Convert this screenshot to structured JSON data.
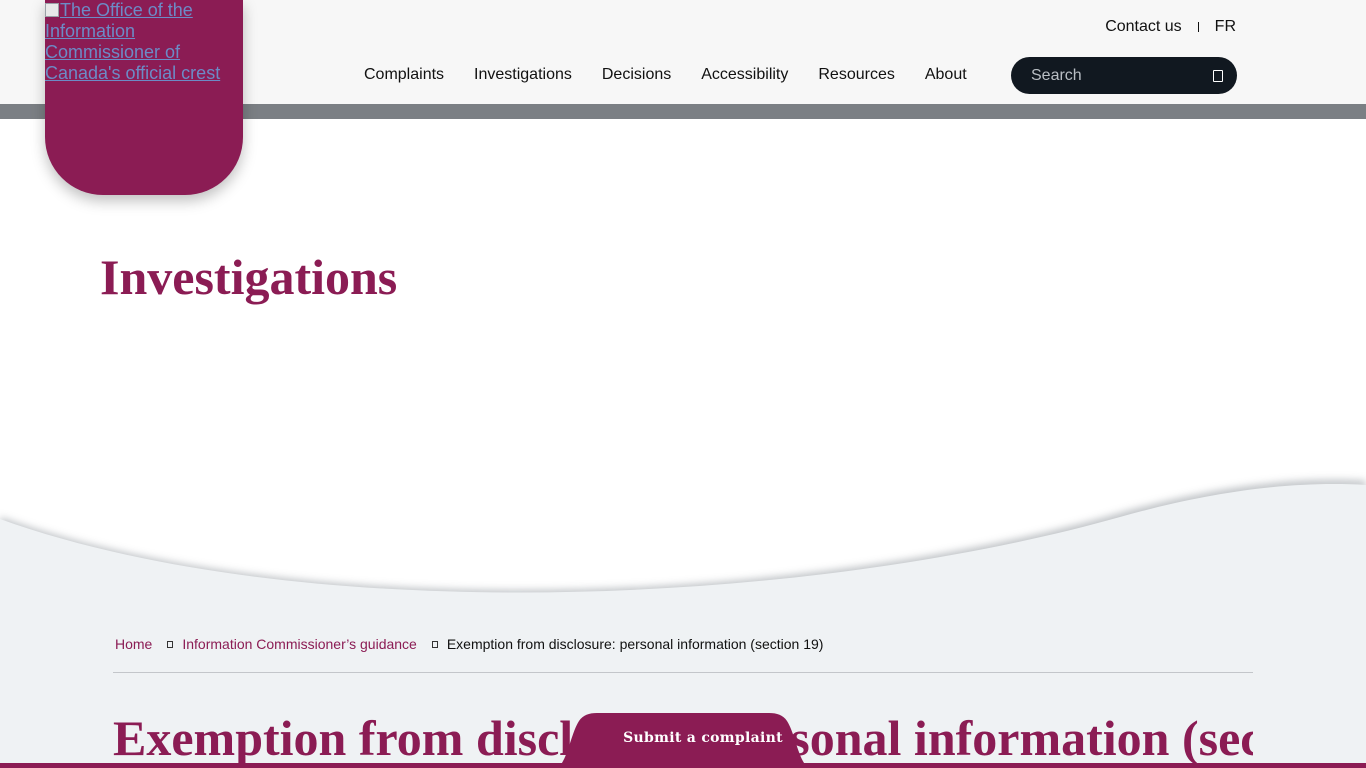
{
  "crest": {
    "alt_text": "The Office of the Information Commissioner of Canada's official crest"
  },
  "utility_nav": {
    "contact_label": "Contact us",
    "language_label": "FR"
  },
  "main_nav": {
    "items": [
      {
        "label": "Complaints"
      },
      {
        "label": "Investigations"
      },
      {
        "label": "Decisions"
      },
      {
        "label": "Accessibility"
      },
      {
        "label": "Resources"
      },
      {
        "label": "About"
      }
    ]
  },
  "search": {
    "placeholder": "Search",
    "value": ""
  },
  "hero": {
    "title": "Investigations"
  },
  "breadcrumb": {
    "items": [
      {
        "label": "Home"
      },
      {
        "label": "Information Commissioner’s guidance"
      },
      {
        "label": "Exemption from disclosure: personal information (section 19)"
      }
    ]
  },
  "page": {
    "title": "Exemption from disclosure: personal information (section"
  },
  "complaint_button": {
    "label": "Submit a complaint"
  },
  "colors": {
    "brand": "#8b1c54",
    "header_bg": "#f7f7f7",
    "header_bar": "#7b7f84",
    "search_bg": "#111820",
    "section_bg": "#eff2f4"
  }
}
